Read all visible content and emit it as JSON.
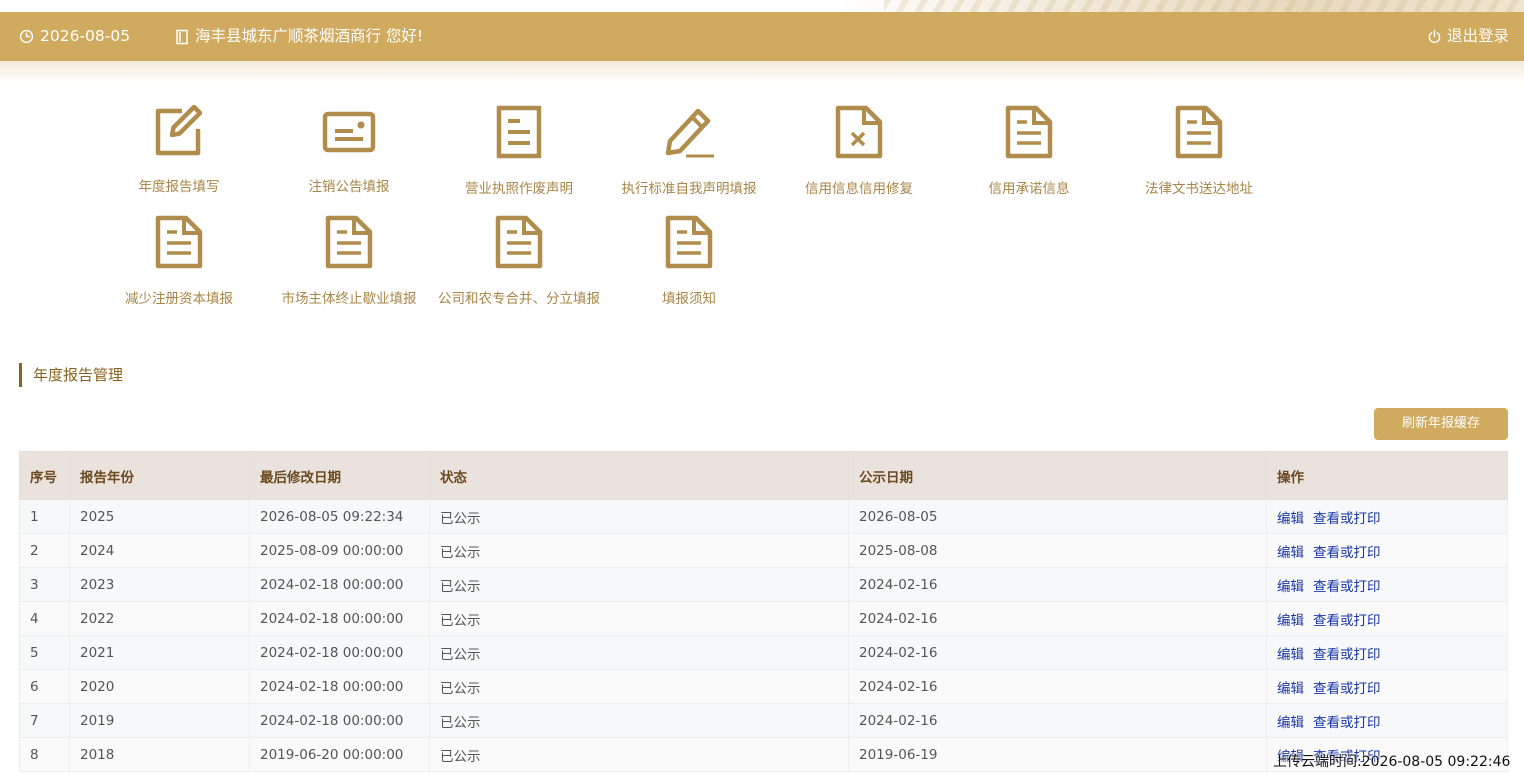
{
  "header": {
    "date": "2026-08-05",
    "greeting": "海丰县城东广顺茶烟酒商行 您好!",
    "logout_label": "退出登录",
    "bar_color": "#d0aa5f"
  },
  "menu": [
    {
      "label": "年度报告填写",
      "icon": "edit-icon"
    },
    {
      "label": "注销公告填报",
      "icon": "id-card-icon"
    },
    {
      "label": "营业执照作废声明",
      "icon": "document-icon"
    },
    {
      "label": "执行标准自我声明填报",
      "icon": "pencil-icon"
    },
    {
      "label": "信用信息信用修复",
      "icon": "document-x-icon"
    },
    {
      "label": "信用承诺信息",
      "icon": "document-icon"
    },
    {
      "label": "法律文书送达地址",
      "icon": "document-icon"
    },
    {
      "label": "减少注册资本填报",
      "icon": "document-icon"
    },
    {
      "label": "市场主体终止歇业填报",
      "icon": "document-icon"
    },
    {
      "label": "公司和农专合并、分立填报",
      "icon": "document-icon"
    },
    {
      "label": "填报须知",
      "icon": "document-icon"
    }
  ],
  "section": {
    "title": "年度报告管理",
    "refresh_label": "刷新年报缓存"
  },
  "table": {
    "columns": [
      "序号",
      "报告年份",
      "最后修改日期",
      "状态",
      "公示日期",
      "操作"
    ],
    "action_edit": "编辑",
    "action_view": "查看或打印",
    "rows": [
      {
        "no": "1",
        "year": "2025",
        "modified": "2026-08-05 09:22:34",
        "status": "已公示",
        "published": "2026-08-05"
      },
      {
        "no": "2",
        "year": "2024",
        "modified": "2025-08-09 00:00:00",
        "status": "已公示",
        "published": "2025-08-08"
      },
      {
        "no": "3",
        "year": "2023",
        "modified": "2024-02-18 00:00:00",
        "status": "已公示",
        "published": "2024-02-16"
      },
      {
        "no": "4",
        "year": "2022",
        "modified": "2024-02-18 00:00:00",
        "status": "已公示",
        "published": "2024-02-16"
      },
      {
        "no": "5",
        "year": "2021",
        "modified": "2024-02-18 00:00:00",
        "status": "已公示",
        "published": "2024-02-16"
      },
      {
        "no": "6",
        "year": "2020",
        "modified": "2024-02-18 00:00:00",
        "status": "已公示",
        "published": "2024-02-16"
      },
      {
        "no": "7",
        "year": "2019",
        "modified": "2024-02-18 00:00:00",
        "status": "已公示",
        "published": "2024-02-16"
      },
      {
        "no": "8",
        "year": "2018",
        "modified": "2019-06-20 00:00:00",
        "status": "已公示",
        "published": "2019-06-19"
      }
    ]
  },
  "upload_time": "上传云端时间:2026-08-05 09:22:46"
}
